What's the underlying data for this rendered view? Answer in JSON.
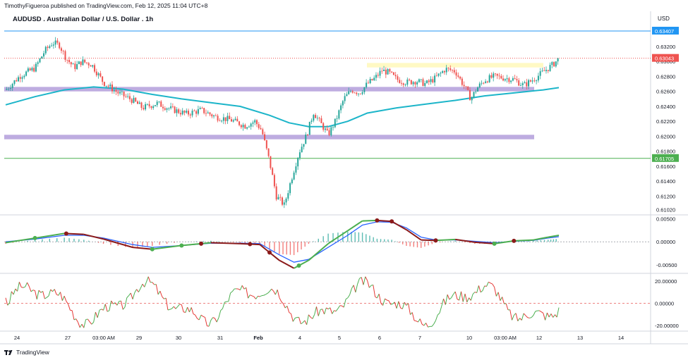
{
  "header": {
    "publisher": "TimothyFigueroa published on TradingView.com, Feb 12, 2025 11:04 UTC+8",
    "title": "AUDUSD . Australian Dollar / U.S. Dollar . 1h",
    "currency": "USD"
  },
  "footer": {
    "brand": "TradingView"
  },
  "colors": {
    "bull": "#26a69a",
    "bear": "#ef5350",
    "ma": "#1cb5c9",
    "zone": "#b39ddb",
    "resistance_zone": "#fff59d",
    "blue_line": "#2196f3",
    "green_line": "#4caf50",
    "macd_fast": "#4caf50",
    "macd_slow": "#2962ff",
    "macd_dark": "#8b1a1a",
    "osc_up": "#4caf50",
    "osc_down": "#e53935"
  },
  "chart_data": [
    {
      "panel": "price",
      "type": "candlestick",
      "ylim": [
        0.6095,
        0.6352
      ],
      "yticks": [
        "0.63200",
        "0.63000",
        "0.62800",
        "0.62600",
        "0.62400",
        "0.62200",
        "0.62000",
        "0.61800",
        "0.61600",
        "0.61400",
        "0.61200",
        "0.61020"
      ],
      "x_labels": [
        "24",
        "27",
        "03:00 AM",
        "29",
        "30",
        "31",
        "Feb",
        "4",
        "5",
        "6",
        "7",
        "10",
        "03:00 AM",
        "12",
        "13",
        "14"
      ],
      "price_labels": [
        {
          "text": "0.63407",
          "value": 0.63407,
          "color": "#2196f3"
        },
        {
          "text": "0.63043",
          "value": 0.63043,
          "color": "#ef5350"
        },
        {
          "text": "0.61705",
          "value": 0.61705,
          "color": "#4caf50"
        }
      ],
      "horizontal_lines": [
        {
          "value": 0.63407,
          "color": "#2196f3",
          "style": "solid"
        },
        {
          "value": 0.63043,
          "color": "#ef5350",
          "style": "dotted"
        },
        {
          "value": 0.61705,
          "color": "#4caf50",
          "style": "solid"
        }
      ],
      "zones": [
        {
          "from_x": "24",
          "to_x": "12",
          "low": 0.626,
          "high": 0.6266,
          "color": "#b39ddb"
        },
        {
          "from_x": "24",
          "to_x": "12",
          "low": 0.6196,
          "high": 0.6202,
          "color": "#b39ddb"
        },
        {
          "from_x": "5",
          "to_x": "12",
          "low": 0.6292,
          "high": 0.6298,
          "color": "#fff59d"
        }
      ],
      "close_path": [
        [
          0,
          0.6262
        ],
        [
          15,
          0.6281
        ],
        [
          30,
          0.6291
        ],
        [
          40,
          0.6314
        ],
        [
          48,
          0.6325
        ],
        [
          55,
          0.6322
        ],
        [
          62,
          0.6304
        ],
        [
          70,
          0.6292
        ],
        [
          78,
          0.63
        ],
        [
          88,
          0.6296
        ],
        [
          100,
          0.6272
        ],
        [
          115,
          0.6258
        ],
        [
          130,
          0.6248
        ],
        [
          140,
          0.6238
        ],
        [
          155,
          0.6244
        ],
        [
          170,
          0.6236
        ],
        [
          185,
          0.623
        ],
        [
          200,
          0.6235
        ],
        [
          215,
          0.6226
        ],
        [
          230,
          0.6222
        ],
        [
          245,
          0.6214
        ],
        [
          255,
          0.622
        ],
        [
          262,
          0.6208
        ],
        [
          270,
          0.6166
        ],
        [
          277,
          0.612
        ],
        [
          285,
          0.6108
        ],
        [
          293,
          0.6146
        ],
        [
          300,
          0.6178
        ],
        [
          308,
          0.6202
        ],
        [
          315,
          0.6232
        ],
        [
          322,
          0.6218
        ],
        [
          330,
          0.6202
        ],
        [
          338,
          0.6222
        ],
        [
          346,
          0.625
        ],
        [
          354,
          0.6262
        ],
        [
          362,
          0.6258
        ],
        [
          370,
          0.627
        ],
        [
          378,
          0.6278
        ],
        [
          385,
          0.6288
        ],
        [
          392,
          0.6285
        ],
        [
          400,
          0.6276
        ],
        [
          410,
          0.6272
        ],
        [
          420,
          0.6274
        ],
        [
          430,
          0.627
        ],
        [
          440,
          0.6278
        ],
        [
          450,
          0.629
        ],
        [
          460,
          0.6287
        ],
        [
          470,
          0.6265
        ],
        [
          476,
          0.625
        ],
        [
          482,
          0.6264
        ],
        [
          490,
          0.6275
        ],
        [
          500,
          0.628
        ],
        [
          510,
          0.6278
        ],
        [
          520,
          0.6276
        ],
        [
          530,
          0.6268
        ],
        [
          540,
          0.6276
        ],
        [
          550,
          0.6286
        ],
        [
          560,
          0.6296
        ],
        [
          566,
          0.6304
        ]
      ],
      "ma_path": [
        [
          0,
          0.6242
        ],
        [
          30,
          0.6253
        ],
        [
          60,
          0.6262
        ],
        [
          90,
          0.6266
        ],
        [
          120,
          0.6263
        ],
        [
          150,
          0.6256
        ],
        [
          180,
          0.625
        ],
        [
          210,
          0.6245
        ],
        [
          240,
          0.624
        ],
        [
          270,
          0.6228
        ],
        [
          290,
          0.6218
        ],
        [
          310,
          0.6213
        ],
        [
          330,
          0.6213
        ],
        [
          350,
          0.622
        ],
        [
          370,
          0.6231
        ],
        [
          400,
          0.6238
        ],
        [
          430,
          0.6243
        ],
        [
          460,
          0.6248
        ],
        [
          490,
          0.6254
        ],
        [
          520,
          0.6258
        ],
        [
          550,
          0.6262
        ],
        [
          566,
          0.6265
        ]
      ]
    },
    {
      "panel": "macd",
      "type": "line",
      "ylim": [
        -0.0068,
        0.0058
      ],
      "yticks": [
        "0.00500",
        "0.00000",
        "-0.00500"
      ],
      "series": [
        {
          "role": "fast",
          "values": [
            [
              0,
              -0.0002
            ],
            [
              30,
              0.0008
            ],
            [
              60,
              0.0018
            ],
            [
              80,
              0.0016
            ],
            [
              100,
              0.0006
            ],
            [
              130,
              -0.0012
            ],
            [
              150,
              -0.0016
            ],
            [
              180,
              -0.0008
            ],
            [
              210,
              -0.0002
            ],
            [
              240,
              -0.0004
            ],
            [
              260,
              -0.0006
            ],
            [
              280,
              -0.004
            ],
            [
              295,
              -0.0057
            ],
            [
              310,
              -0.004
            ],
            [
              330,
              -0.0004
            ],
            [
              350,
              0.0024
            ],
            [
              365,
              0.0045
            ],
            [
              380,
              0.0046
            ],
            [
              395,
              0.0044
            ],
            [
              410,
              0.0026
            ],
            [
              425,
              0.0004
            ],
            [
              440,
              0.0003
            ],
            [
              460,
              0.0005
            ],
            [
              480,
              -0.0001
            ],
            [
              500,
              -0.0004
            ],
            [
              520,
              0.0002
            ],
            [
              540,
              0.0004
            ],
            [
              555,
              0.001
            ],
            [
              566,
              0.0014
            ]
          ]
        },
        {
          "role": "slow",
          "values": [
            [
              0,
              0.0
            ],
            [
              30,
              0.0006
            ],
            [
              60,
              0.0014
            ],
            [
              80,
              0.0014
            ],
            [
              100,
              0.0008
            ],
            [
              130,
              -0.0006
            ],
            [
              150,
              -0.0012
            ],
            [
              180,
              -0.0008
            ],
            [
              210,
              -0.0003
            ],
            [
              240,
              -0.0003
            ],
            [
              260,
              -0.0004
            ],
            [
              280,
              -0.0028
            ],
            [
              295,
              -0.0044
            ],
            [
              310,
              -0.0038
            ],
            [
              330,
              -0.0012
            ],
            [
              350,
              0.0014
            ],
            [
              365,
              0.0036
            ],
            [
              380,
              0.0043
            ],
            [
              395,
              0.0042
            ],
            [
              410,
              0.003
            ],
            [
              425,
              0.001
            ],
            [
              440,
              0.0004
            ],
            [
              460,
              0.0004
            ],
            [
              480,
              0.0001
            ],
            [
              500,
              -0.0002
            ],
            [
              520,
              0.0001
            ],
            [
              540,
              0.0003
            ],
            [
              555,
              0.0008
            ],
            [
              566,
              0.0011
            ]
          ]
        }
      ]
    },
    {
      "panel": "oscillator",
      "type": "line",
      "ylim": [
        -25,
        27
      ],
      "yticks": [
        "20.00000",
        "0.00000",
        "-20.00000"
      ]
    }
  ]
}
